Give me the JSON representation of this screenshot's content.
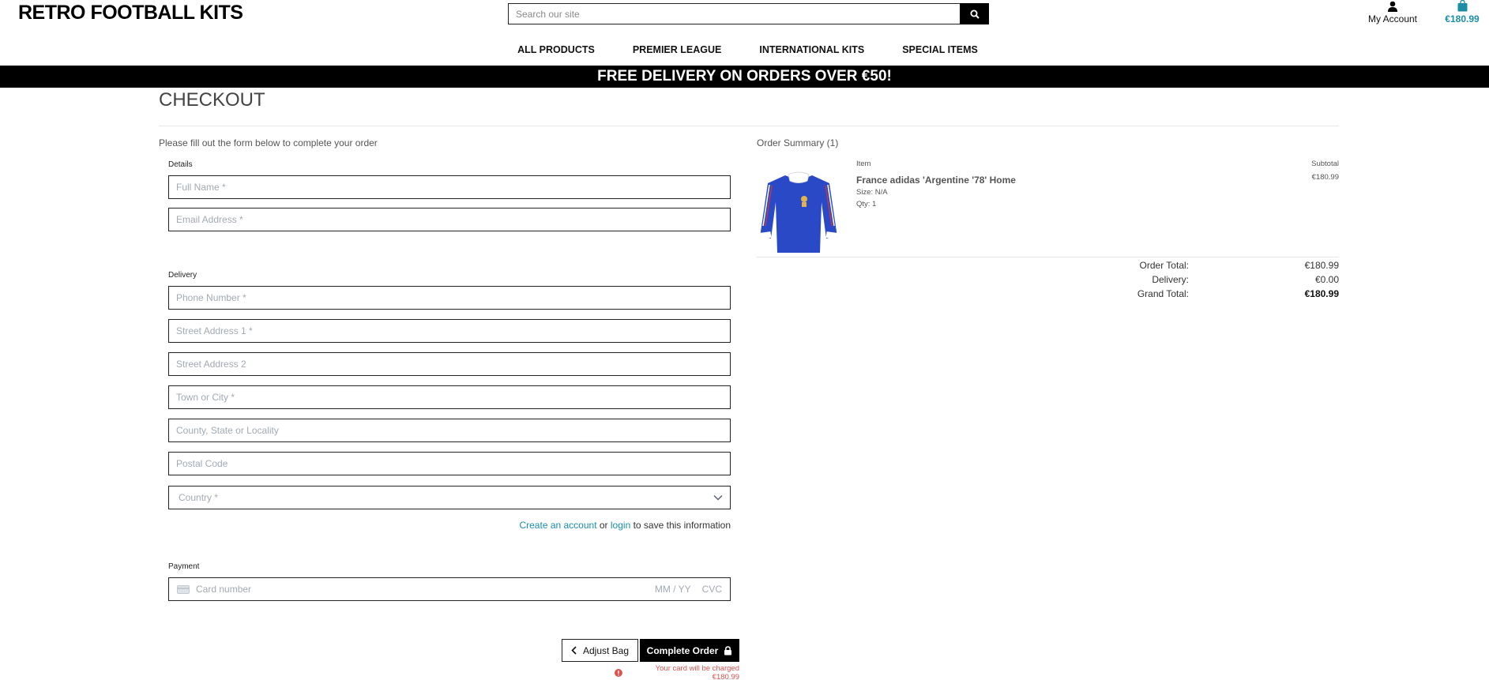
{
  "header": {
    "brand": "RETRO FOOTBALL KITS",
    "search_placeholder": "Search our site",
    "account_label": "My Account",
    "bag_total": "€180.99"
  },
  "nav": {
    "items": [
      "ALL PRODUCTS",
      "PREMIER LEAGUE",
      "INTERNATIONAL KITS",
      "SPECIAL ITEMS"
    ]
  },
  "banner": "FREE DELIVERY ON ORDERS OVER €50!",
  "checkout": {
    "title": "CHECKOUT",
    "instructions": "Please fill out the form below to complete your order",
    "details_legend": "Details",
    "delivery_legend": "Delivery",
    "payment_legend": "Payment",
    "fields": {
      "full_name": "Full Name *",
      "email": "Email Address *",
      "phone": "Phone Number *",
      "street1": "Street Address 1 *",
      "street2": "Street Address 2",
      "town": "Town or City *",
      "county": "County, State or Locality",
      "postcode": "Postal Code",
      "country": "Country *"
    },
    "save_info": {
      "create_link": "Create an account",
      "or": "or",
      "login_link": "login",
      "suffix": "to save this information"
    },
    "card": {
      "number": "Card number",
      "expiry": "MM / YY",
      "cvc": "CVC"
    },
    "adjust_bag": "Adjust Bag",
    "complete_order": "Complete Order",
    "charge_notice": "Your card will be charged €180.99"
  },
  "summary": {
    "title": "Order Summary (1)",
    "col_item": "Item",
    "col_subtotal": "Subtotal",
    "product": {
      "name": "France adidas 'Argentine '78' Home",
      "size": "Size: N/A",
      "qty": "Qty: 1",
      "subtotal": "€180.99"
    },
    "order_total_label": "Order Total:",
    "order_total": "€180.99",
    "delivery_label": "Delivery:",
    "delivery": "€0.00",
    "grand_total_label": "Grand Total:",
    "grand_total": "€180.99"
  },
  "colors": {
    "accent": "#1a8ea6",
    "error": "#d9534f",
    "banner_bg": "#000000",
    "shirt_blue": "#2a49c7"
  }
}
